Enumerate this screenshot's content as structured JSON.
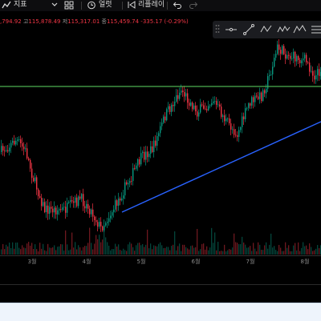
{
  "toolbar": {
    "indicators_label": "지표",
    "alert_label": "얼럿",
    "replay_label": "리플레이"
  },
  "ohlc": {
    "open_value": ",794.92",
    "high_label": "고",
    "high_value": "115,878.49",
    "low_label": "저",
    "low_value": "115,317.01",
    "close_label": "종",
    "close_value": "115,459.74",
    "change": "-335.17 (-0.29%)"
  },
  "colors": {
    "up": "#089981",
    "down": "#f23645",
    "trendline": "#2962ff",
    "horizontal_line": "#4caf50",
    "background": "#000000"
  },
  "chart_data": {
    "type": "candlestick",
    "x_axis_labels": [
      "3월",
      "4월",
      "5월",
      "6월",
      "7월",
      "8월"
    ],
    "y_axis_visible": false,
    "horizontal_line_level": 108000,
    "trendline": {
      "start": {
        "month": "4월 하순",
        "price": 81500
      },
      "end": {
        "month": "8월",
        "price": 99000
      }
    },
    "volume_pane": true,
    "grid": false,
    "approx_path": {
      "months": [
        "2월 초",
        "2월 중순",
        "2월 말",
        "3월 중순",
        "4월 초",
        "4월 하순",
        "5월 초",
        "5월 중순",
        "5월 하순",
        "6월 초",
        "6월 하순",
        "7월 초",
        "7월 중순",
        "7월 말",
        "8월 초"
      ],
      "close": [
        100000,
        96000,
        86000,
        83000,
        84000,
        79000,
        96000,
        104000,
        109000,
        104000,
        106000,
        109000,
        118000,
        119000,
        116000
      ]
    }
  }
}
